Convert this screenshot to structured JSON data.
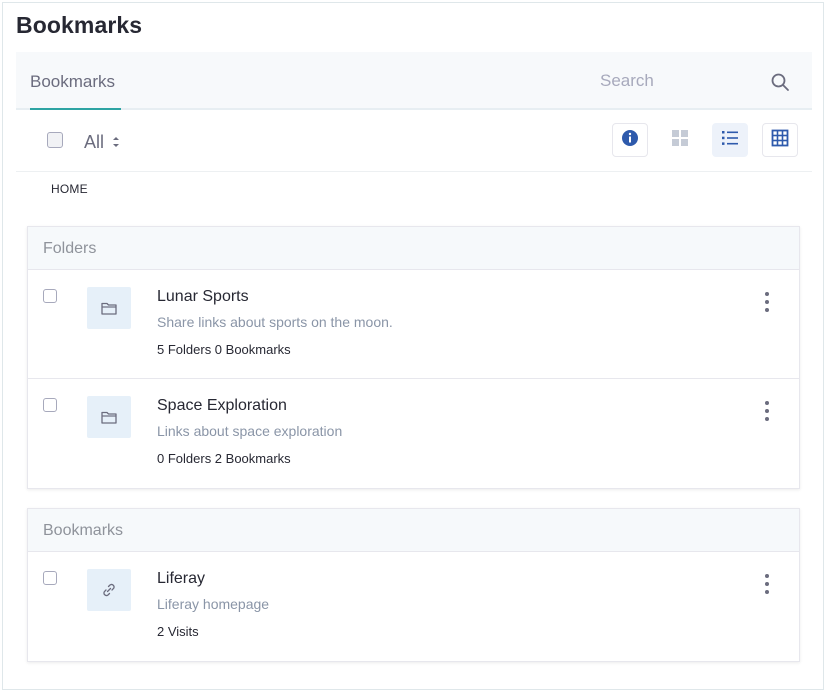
{
  "page": {
    "title": "Bookmarks"
  },
  "navbar": {
    "tab_label": "Bookmarks",
    "search_placeholder": "Search",
    "search_icon": "search-icon"
  },
  "management_bar": {
    "filter_label": "All",
    "view_buttons": [
      {
        "name": "info-icon",
        "active": false
      },
      {
        "name": "cards-view-icon",
        "active": false
      },
      {
        "name": "list-view-icon",
        "active": true
      },
      {
        "name": "table-view-icon",
        "active": false
      }
    ]
  },
  "breadcrumb": {
    "home": "HOME"
  },
  "folders_section": {
    "header": "Folders",
    "items": [
      {
        "title": "Lunar Sports",
        "description": "Share links about sports on the moon.",
        "meta": "5 Folders 0 Bookmarks",
        "icon": "folder-icon"
      },
      {
        "title": "Space Exploration",
        "description": "Links about space exploration",
        "meta": "0 Folders 2 Bookmarks",
        "icon": "folder-icon"
      }
    ]
  },
  "bookmarks_section": {
    "header": "Bookmarks",
    "items": [
      {
        "title": "Liferay",
        "description": "Liferay homepage",
        "meta": "2 Visits",
        "icon": "link-icon"
      }
    ]
  },
  "colors": {
    "accent": "#2ea4a3",
    "primary": "#0b5fff",
    "info": "#2e5aac"
  }
}
